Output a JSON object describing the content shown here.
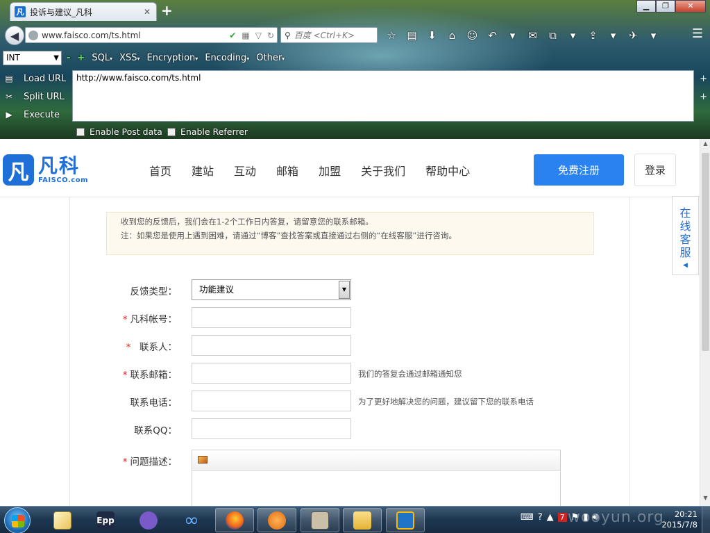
{
  "browser": {
    "tab_title": "投诉与建议_凡科",
    "tab_favicon": "凡",
    "new_tab": "+",
    "url": "www.faisco.com/ts.html",
    "search_placeholder": "百度 <Ctrl+K>",
    "window_buttons": [
      "minimize",
      "maximize",
      "close"
    ],
    "toolbar_icons": [
      "star-icon",
      "reading-list-icon",
      "download-icon",
      "home-icon",
      "smiley-icon",
      "back-arrow-icon",
      "chat-icon",
      "screenshot-icon",
      "upload-icon",
      "tools-icon",
      "menu-icon"
    ]
  },
  "hackbar": {
    "select_value": "INT",
    "menus": [
      "SQL",
      "XSS",
      "Encryption",
      "Encoding",
      "Other"
    ],
    "load_url": "Load URL",
    "split_url": "Split URL",
    "execute": "Execute",
    "url_text": "http://www.faisco.com/ts.html",
    "enable_post": "Enable Post data",
    "enable_referrer": "Enable Referrer"
  },
  "site": {
    "logo_cn": "凡科",
    "logo_en": "FAISCO.com",
    "logo_mark": "凡",
    "nav": [
      "首页",
      "建站",
      "互动",
      "邮箱",
      "加盟",
      "关于我们",
      "帮助中心"
    ],
    "register": "免费注册",
    "login": "登录",
    "online_service": "在线客服"
  },
  "notice": {
    "line1": "收到您的反馈后，我们会在1-2个工作日内答复，请留意您的联系邮箱。",
    "line2": "注：如果您是使用上遇到困难，请通过“博客”查找答案或直接通过右侧的“在线客服”进行咨询。"
  },
  "form": {
    "feedback_type_label": "反馈类型：",
    "feedback_type_value": "功能建议",
    "account_label": "凡科帐号：",
    "contact_label": "联系人：",
    "email_label": "联系邮箱：",
    "email_hint": "我们的答复会通过邮箱通知您",
    "phone_label": "联系电话：",
    "phone_hint": "为了更好地解决您的问题，建议留下您的联系电话",
    "qq_label": "联系QQ：",
    "description_label": "问题描述：",
    "required_mark": "*"
  },
  "taskbar": {
    "apps": [
      "notepad",
      "epp",
      "cat-app",
      "infinity-app",
      "firefox",
      "foxmail",
      "app-dark",
      "explorer",
      "virtualbox"
    ],
    "time": "20:21",
    "date": "2015/7/8",
    "watermark": "wooyun.org"
  }
}
